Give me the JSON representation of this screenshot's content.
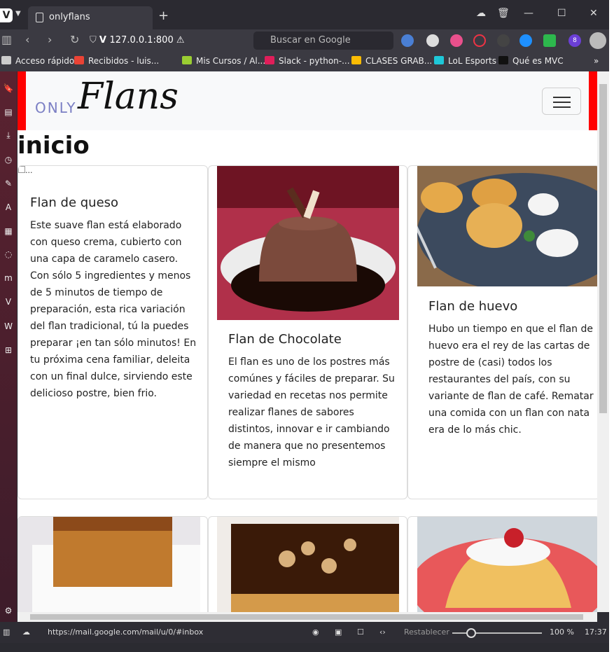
{
  "browser": {
    "tab_title": "onlyflans",
    "url": "127.0.0.1:800",
    "search_placeholder": "Buscar en Google",
    "extension_badge": "8",
    "status_url": "https://mail.google.com/mail/u/0/#inbox",
    "reset_label": "Restablecer",
    "zoom": "100 %",
    "time": "17:37"
  },
  "bookmarks": [
    {
      "label": "Acceso rápido",
      "color": "#cccccc"
    },
    {
      "label": "Recibidos - luis...",
      "color": "#ea4335"
    },
    {
      "label": "Mis Cursos / Al...",
      "color": "#9acd32"
    },
    {
      "label": "Slack - python-...",
      "color": "#e01e5a"
    },
    {
      "label": "CLASES GRAB...",
      "color": "#fbbc04"
    },
    {
      "label": "LoL Esports",
      "color": "#1ec8d8"
    },
    {
      "label": "Qué es MVC",
      "color": "#111111"
    }
  ],
  "site": {
    "brand_only": "ONLY",
    "brand_flans": "Flans",
    "heading": "inicio",
    "broken_img_alt": "..."
  },
  "cards": [
    {
      "title": "Flan de queso",
      "text": "Este suave flan está elaborado con queso crema, cubierto con una capa de caramelo casero. Con sólo 5 ingredientes y menos de 5 minutos de tiempo de preparación, esta rica variación del flan tradicional, tú la puedes preparar ¡en tan sólo minutos! En tu próxima cena familiar, deleita con un final dulce, sirviendo este delicioso postre, bien frio."
    },
    {
      "title": "Flan de Chocolate",
      "text": "El flan es uno de los postres más comúnes y fáciles de preparar. Su variedad en recetas nos permite realizar flanes de sabores distintos, innovar e ir cambiando de manera que no presentemos siempre el mismo"
    },
    {
      "title": "Flan de huevo",
      "text": "Hubo un tiempo en que el flan de huevo era el rey de las cartas de postre de (casi) todos los restaurantes del país, con su variante de flan de café. Rematar una comida con un flan con nata era de lo más chic."
    }
  ]
}
